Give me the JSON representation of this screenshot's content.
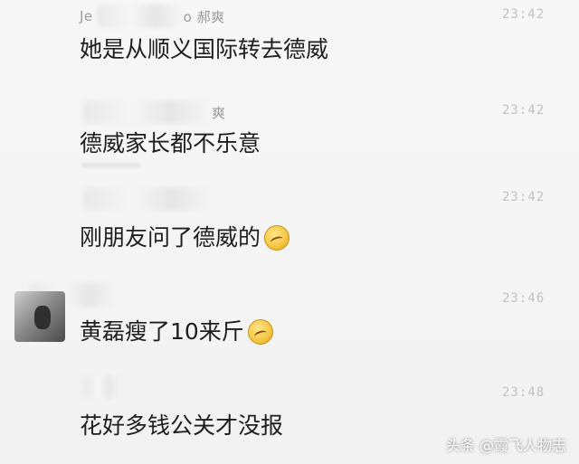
{
  "messages": [
    {
      "sender_prefix": "Je",
      "sender_suffix": "o 郝爽",
      "time": "23:42",
      "text": "她是从顺义国际转去德威",
      "emoji": null
    },
    {
      "sender_prefix": "",
      "sender_suffix": "爽",
      "time": "23:42",
      "text": "德威家长都不乐意",
      "emoji": null
    },
    {
      "sender_prefix": "",
      "sender_suffix": "",
      "time": "23:42",
      "text": "刚朋友问了德威的",
      "emoji": "grimace-emoji"
    },
    {
      "sender_prefix": "",
      "sender_suffix": "",
      "time": "23:46",
      "text": "黄磊瘦了10来斤",
      "emoji": "grimace-emoji"
    },
    {
      "sender_prefix": "",
      "sender_suffix": "",
      "time": "23:48",
      "text": "花好多钱公关才没报",
      "emoji": null
    }
  ],
  "watermark": "头条 @霞飞人物志",
  "colors": {
    "background": "#f3f3f3",
    "text": "#1e1e1e",
    "time": "#c2c2c2",
    "watermark": "#ffffff"
  }
}
